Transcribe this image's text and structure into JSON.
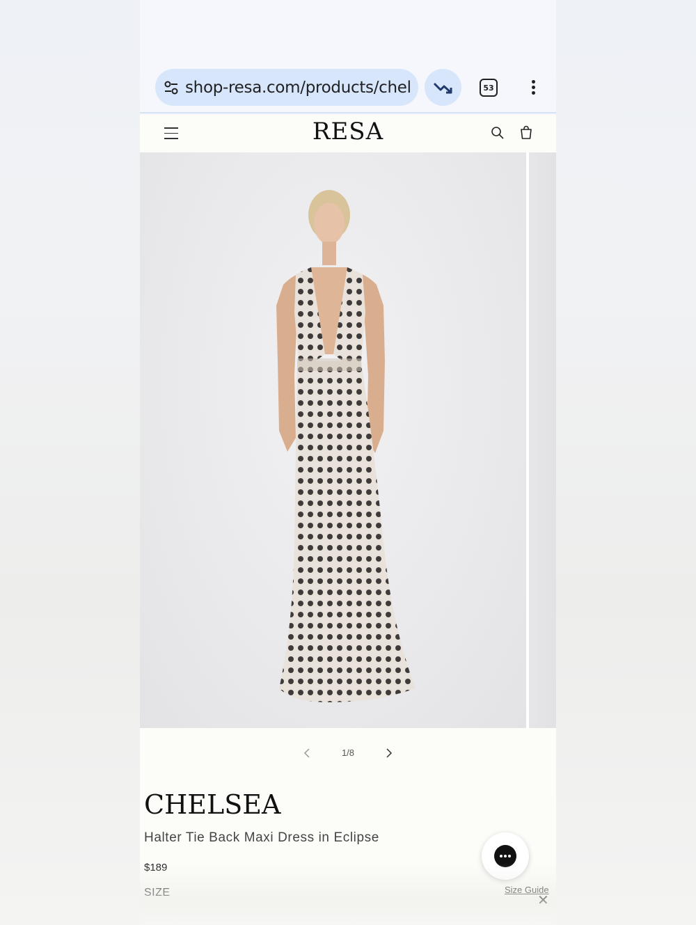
{
  "browser": {
    "url": "shop-resa.com/products/chel",
    "tab_count": "53",
    "icons": [
      "tune-icon",
      "trending-down-icon",
      "tabs-icon",
      "more-vert-icon"
    ]
  },
  "site": {
    "logo": "RESA",
    "icons": [
      "hamburger-menu-icon",
      "search-icon",
      "cart-icon"
    ]
  },
  "gallery": {
    "image_alt": "Model wearing polka dot halter maxi dress",
    "counter": "1/8"
  },
  "product": {
    "name": "CHELSEA",
    "subtitle": "Halter Tie Back Maxi Dress in Eclipse",
    "price": "$189",
    "size_label": "SIZE",
    "size_guide": "Size Guide"
  },
  "chat": {
    "icon": "chat-bubble-icon"
  },
  "close": {
    "label": "✕"
  }
}
